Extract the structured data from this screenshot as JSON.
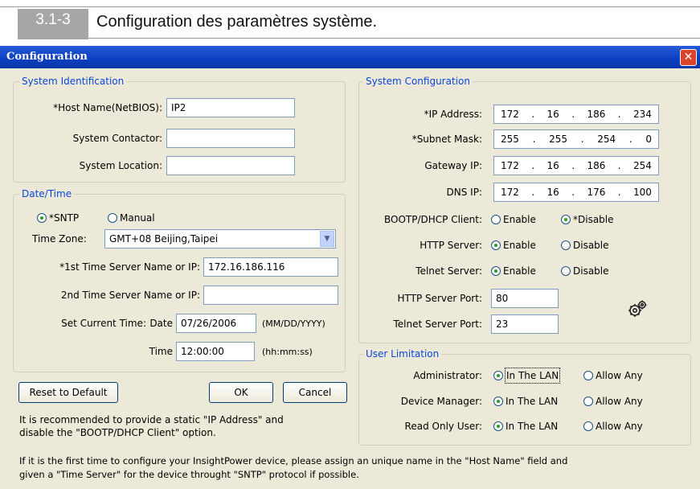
{
  "header": {
    "badge": "3.1-3",
    "title": "Configuration des paramètres système."
  },
  "window": {
    "title": "Configuration",
    "close": "✕"
  },
  "system_identification": {
    "legend": "System Identification",
    "host_name": {
      "label": "*Host Name(NetBIOS):",
      "value": "IP2"
    },
    "system_contactor": {
      "label": "System Contactor:",
      "value": ""
    },
    "system_location": {
      "label": "System Location:",
      "value": ""
    }
  },
  "date_time": {
    "legend": "Date/Time",
    "sntp": "*SNTP",
    "manual": "Manual",
    "time_zone": {
      "label": "Time Zone:",
      "value": "GMT+08 Beijing,Taipei"
    },
    "server1": {
      "label": "*1st Time Server Name or IP:",
      "value": "172.16.186.116"
    },
    "server2": {
      "label": "2nd Time Server Name or IP:",
      "value": ""
    },
    "set_current_time": "Set Current Time:",
    "date": {
      "label": "Date",
      "value": "07/26/2006",
      "format": "(MM/DD/YYYY)"
    },
    "time": {
      "label": "Time",
      "value": "12:00:00",
      "format": "(hh:mm:ss)"
    }
  },
  "system_configuration": {
    "legend": "System Configuration",
    "ip_address": {
      "label": "*IP Address:",
      "octets": [
        "172",
        "16",
        "186",
        "234"
      ]
    },
    "subnet_mask": {
      "label": "*Subnet Mask:",
      "octets": [
        "255",
        "255",
        "254",
        "0"
      ]
    },
    "gateway_ip": {
      "label": "Gateway IP:",
      "octets": [
        "172",
        "16",
        "186",
        "254"
      ]
    },
    "dns_ip": {
      "label": "DNS IP:",
      "octets": [
        "172",
        "16",
        "176",
        "100"
      ]
    },
    "bootp": {
      "label": "BOOTP/DHCP Client:",
      "enable": "Enable",
      "disable": "*Disable"
    },
    "http": {
      "label": "HTTP Server:",
      "enable": "Enable",
      "disable": "Disable"
    },
    "telnet": {
      "label": "Telnet Server:",
      "enable": "Enable",
      "disable": "Disable"
    },
    "http_port": {
      "label": "HTTP Server Port:",
      "value": "80"
    },
    "telnet_port": {
      "label": "Telnet Server Port:",
      "value": "23"
    }
  },
  "user_limitation": {
    "legend": "User Limitation",
    "administrator": {
      "label": "Administrator:",
      "lan": "In The LAN",
      "any": "Allow Any"
    },
    "device_manager": {
      "label": "Device Manager:",
      "lan": "In The LAN",
      "any": "Allow Any"
    },
    "read_only": {
      "label": "Read Only User:",
      "lan": "In The LAN",
      "any": "Allow Any"
    }
  },
  "buttons": {
    "reset": "Reset to Default",
    "ok": "OK",
    "cancel": "Cancel"
  },
  "notes": {
    "recommend_1": "It is recommended to provide a static \"IP Address\" and",
    "recommend_2": "disable the \"BOOTP/DHCP Client\" option.",
    "first_time_1": "If it is the first time to configure your InsightPower device, please assign an unique name in the \"Host Name\" field and",
    "first_time_2": "given a \"Time Server\" for the device throught \"SNTP\" protocol if possible."
  },
  "icons": {
    "close": "close-icon",
    "gear": "gear-icon",
    "dropdown": "chevron-down-icon"
  }
}
